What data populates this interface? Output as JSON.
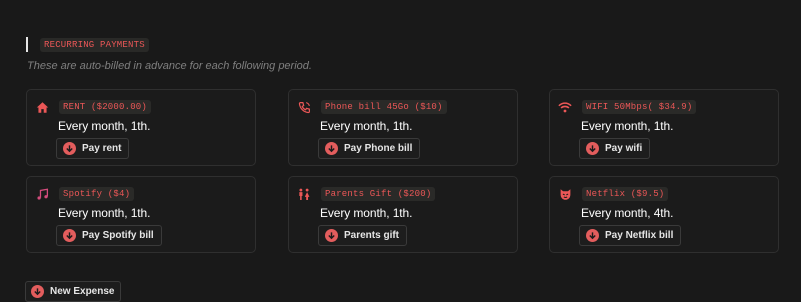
{
  "section": {
    "title": "RECURRING PAYMENTS",
    "subtitle": "These are auto-billed in advance for each following period."
  },
  "colors": {
    "accent": "#eb5757",
    "button_circle": "#e35d5d",
    "background": "#191919",
    "card_border": "#2f2f2f"
  },
  "payments": [
    {
      "icon": "home-icon",
      "tag": "RENT ($2000.00)",
      "frequency": "Every month, 1th.",
      "button": "Pay rent"
    },
    {
      "icon": "phone-icon",
      "tag": "Phone bill 45Go ($10)",
      "frequency": "Every month, 1th.",
      "button": "Pay Phone bill"
    },
    {
      "icon": "wifi-icon",
      "tag": "WIFI 50Mbps( $34.9)",
      "frequency": "Every month, 1th.",
      "button": "Pay wifi"
    },
    {
      "icon": "music-note-icon",
      "tag": "Spotify ($4)",
      "frequency": "Every month, 1th.",
      "button": "Pay Spotify bill"
    },
    {
      "icon": "people-icon",
      "tag": "Parents Gift ($200)",
      "frequency": "Every month, 1th.",
      "button": "Parents gift"
    },
    {
      "icon": "theater-mask-icon",
      "tag": "Netflix ($9.5)",
      "frequency": "Every month, 4th.",
      "button": "Pay Netflix bill"
    }
  ],
  "new_expense_button": "New Expense"
}
